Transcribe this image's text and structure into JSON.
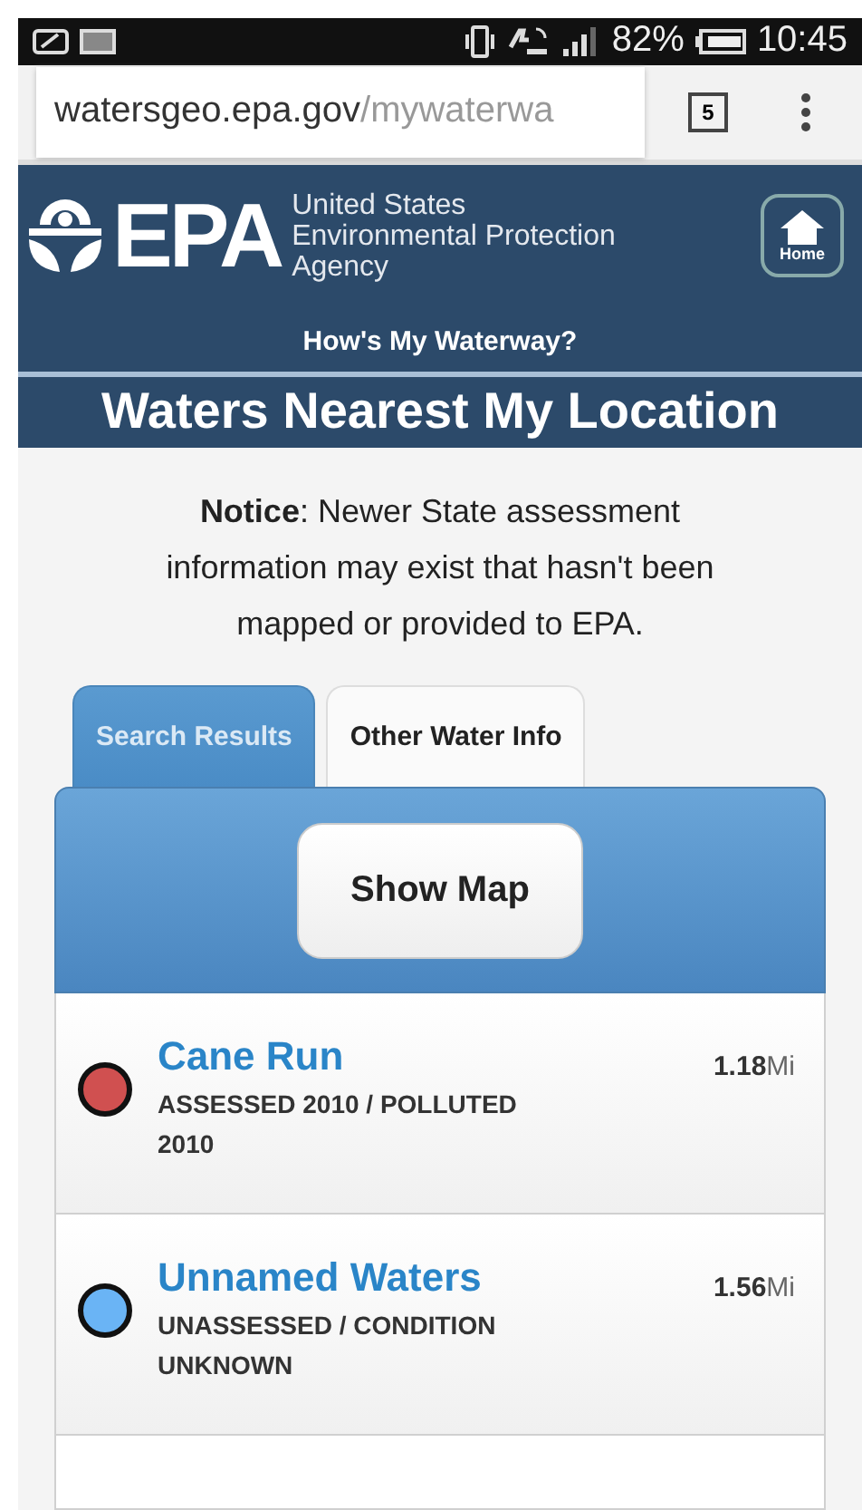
{
  "status_bar": {
    "battery": "82%",
    "time": "10:45"
  },
  "browser": {
    "url_host": "watersgeo.epa.gov",
    "url_path": "/mywaterwa",
    "tab_count": "5"
  },
  "header": {
    "logo": "EPA",
    "agency": [
      "United States",
      "Environmental Protection",
      "Agency"
    ],
    "home_button": "Home",
    "subtitle": "How's My Waterway?",
    "title": "Waters Nearest My Location"
  },
  "notice": "**Notice**: Newer State assessment information may exist that hasn't been mapped or provided to EPA.",
  "tabs": [
    {
      "label": "Search Results",
      "selected": true
    },
    {
      "label": "Other Water Info",
      "selected": false
    }
  ],
  "show_map_button": "Show Map",
  "results": [
    {
      "name": "Cane Run",
      "status": "ASSESSED 2010 / POLLUTED 2010",
      "distance": "1.18",
      "unit": "Mi",
      "color": "#d05050"
    },
    {
      "name": "Unnamed Waters",
      "status": "UNASSESSED / CONDITION UNKNOWN",
      "distance": "1.56",
      "unit": "Mi",
      "color": "#6ab4f5"
    }
  ]
}
